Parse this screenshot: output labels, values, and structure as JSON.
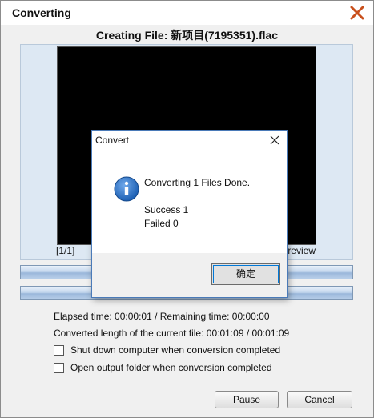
{
  "window": {
    "title": "Converting",
    "heading": "Creating File: 新项目(7195351).flac"
  },
  "preview": {
    "counter": "[1/1]",
    "preview_label": "review"
  },
  "progress": {
    "file_progress": 1.0,
    "total_progress": 1.0
  },
  "info": {
    "time_line": "Elapsed time:  00:00:01 / Remaining time:  00:00:00",
    "length_line": "Converted length of the current file:  00:01:09 / 00:01:09"
  },
  "options": [
    {
      "label": "Shut down computer when conversion completed",
      "checked": false
    },
    {
      "label": "Open output folder when conversion completed",
      "checked": false
    }
  ],
  "buttons": {
    "pause": "Pause",
    "cancel": "Cancel"
  },
  "dialog": {
    "title": "Convert",
    "message": "Converting 1 Files Done.",
    "success": "Success 1",
    "failed": "Failed 0",
    "ok": "确定"
  },
  "colors": {
    "close_x": "#c9501c",
    "progress_bar": "#9ab7da",
    "info_icon": "#1c5fb3"
  },
  "icons": {
    "window_close": "close-icon",
    "dialog_close": "close-icon",
    "dialog_status": "info-icon"
  }
}
